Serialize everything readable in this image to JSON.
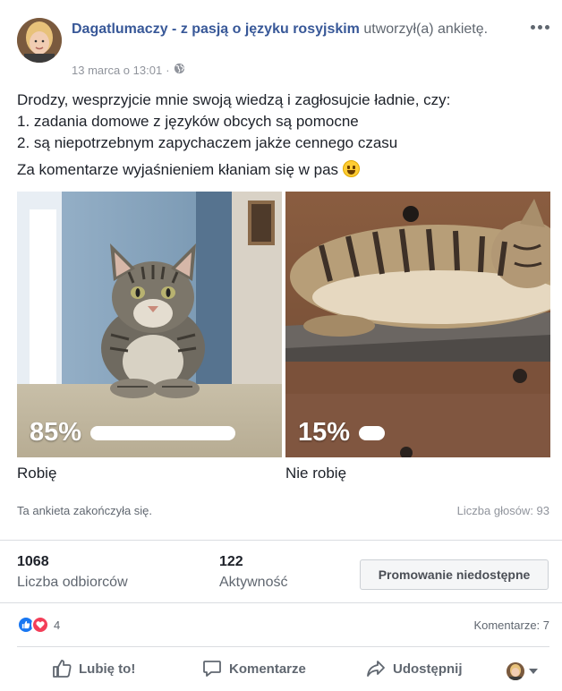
{
  "post": {
    "author": "Dagatlumaczy - z pasją o języku rosyjskim",
    "action": " utworzył(a) ankietę.",
    "date": "13 marca o 13:01",
    "meta_separator": "·",
    "privacy_icon": "globe-icon",
    "more_icon": "more-horizontal-icon",
    "text_lines": [
      "Drodzy, wesprzyjcie mnie swoją wiedzą i zagłosujcie ładnie, czy:",
      "1. zadania domowe z języków obcych są pomocne",
      "2. są niepotrzebnym zapychaczem jakże cennego czasu"
    ],
    "text_closing": "Za komentarze wyjaśnieniem kłaniam się w pas"
  },
  "poll": {
    "options": [
      {
        "label": "Robię",
        "percent_text": "85%",
        "fraction": 0.85
      },
      {
        "label": "Nie robię",
        "percent_text": "15%",
        "fraction": 0.15
      }
    ],
    "status": "Ta ankieta zakończyła się.",
    "votes": "Liczba głosów: 93"
  },
  "stats": {
    "reach_value": "1068",
    "reach_label": "Liczba odbiorców",
    "engagement_value": "122",
    "engagement_label": "Aktywność",
    "promote_label": "Promowanie niedostępne"
  },
  "reactions": {
    "count": "4",
    "comments": "Komentarze: 7",
    "colors": {
      "like": "#1877f2",
      "love": "#f33e58"
    }
  },
  "actions": {
    "like": "Lubię to!",
    "comment": "Komentarze",
    "share": "Udostępnij"
  },
  "colors": {
    "link": "#385898",
    "text": "#1d2129",
    "muted": "#606770",
    "divider": "#dadde1"
  }
}
